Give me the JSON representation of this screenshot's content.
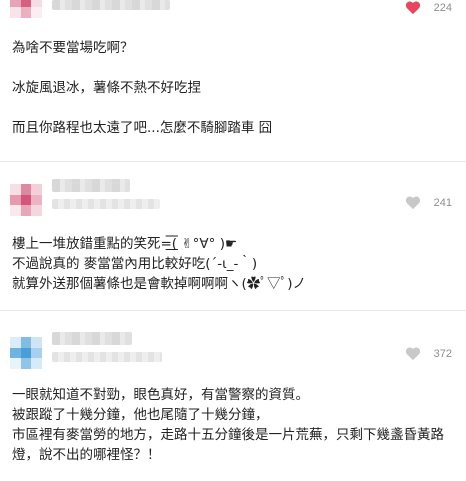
{
  "comments": [
    {
      "likes": "224",
      "liked": true,
      "lines": [
        "為啥不要當場吃啊？",
        "",
        "冰旋風退冰，薯條不熱不好吃捏",
        "",
        "而且你路程也太遠了吧...怎麼不騎腳踏車 囧"
      ]
    },
    {
      "likes": "241",
      "liked": false,
      "lines": [
        "樓上一堆放錯重點的笑死=͟͟͞͞( ✌°∀° )☛",
        "不過說真的 麥當當內用比較好吃(´-ι_-｀)",
        "就算外送那個薯條也是會軟掉啊啊啊ヽ(✿ﾟ▽ﾟ)ノ"
      ]
    },
    {
      "likes": "372",
      "liked": false,
      "lines": [
        "一眼就知道不對勁，眼色真好，有當警察的資質。",
        "被跟蹤了十幾分鐘，他也尾隨了十幾分鐘，",
        "市區裡有麥當勞的地方，走路十五分鐘後是一片荒蕪，只剩下幾盞昏黃路",
        "燈，說不出的哪裡怪？！"
      ]
    }
  ],
  "colors": {
    "heart_active": "#e8455f",
    "heart_inactive": "#c8c8c8",
    "avatar_pink": "#d9738f",
    "avatar_blue": "#4a9fd9"
  }
}
